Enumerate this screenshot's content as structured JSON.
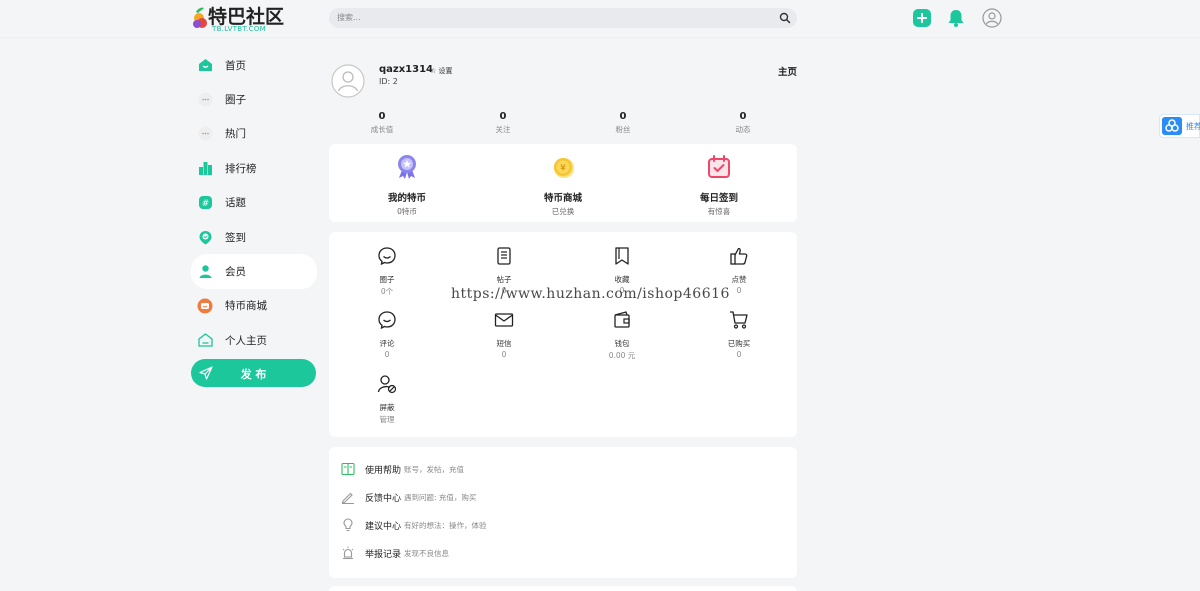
{
  "header": {
    "logo_title": "特巴社区",
    "logo_sub": "TB.LVTBT.COM",
    "search_placeholder": "搜索...",
    "icons": [
      "plus-icon",
      "bell-icon",
      "user-icon"
    ]
  },
  "sidebar": {
    "items": [
      {
        "label": "首页",
        "icon": "home-icon"
      },
      {
        "label": "圈子",
        "icon": "ellipsis-icon"
      },
      {
        "label": "热门",
        "icon": "ellipsis-icon"
      },
      {
        "label": "排行榜",
        "icon": "ranking-icon"
      },
      {
        "label": "话题",
        "icon": "hashtag-icon"
      },
      {
        "label": "签到",
        "icon": "checkin-icon"
      },
      {
        "label": "会员",
        "icon": "member-icon"
      },
      {
        "label": "特币商城",
        "icon": "shop-icon"
      },
      {
        "label": "个人主页",
        "icon": "home-outline-icon"
      }
    ],
    "active_index": 6,
    "publish_label": "发 布"
  },
  "profile": {
    "username": "qazx1314",
    "settings_label": "☆ 设置",
    "user_id": "ID: 2",
    "homepage_label": "主页",
    "stats": [
      {
        "value": "0",
        "label": "成长值"
      },
      {
        "value": "0",
        "label": "关注"
      },
      {
        "value": "0",
        "label": "粉丝"
      },
      {
        "value": "0",
        "label": "动态"
      }
    ]
  },
  "features": [
    {
      "title": "我的特币",
      "sub": "0特币",
      "icon": "medal-icon"
    },
    {
      "title": "特币商城",
      "sub": "已兑换",
      "icon": "coin-icon"
    },
    {
      "title": "每日签到",
      "sub": "有惊喜",
      "icon": "calendar-check-icon"
    }
  ],
  "grid": [
    {
      "label": "圈子",
      "value": "0个",
      "icon": "circle-chat-icon"
    },
    {
      "label": "帖子",
      "value": "0",
      "icon": "document-icon"
    },
    {
      "label": "收藏",
      "value": "0",
      "icon": "bookmark-icon"
    },
    {
      "label": "点赞",
      "value": "0",
      "icon": "thumbs-up-icon"
    },
    {
      "label": "评论",
      "value": "0",
      "icon": "comment-icon"
    },
    {
      "label": "短信",
      "value": "0",
      "icon": "mail-icon"
    },
    {
      "label": "钱包",
      "value": "0.00 元",
      "icon": "wallet-icon"
    },
    {
      "label": "已购买",
      "value": "0",
      "icon": "cart-icon"
    },
    {
      "label": "屏蔽",
      "value": "管理",
      "icon": "block-user-icon"
    }
  ],
  "help": [
    {
      "title": "使用帮助",
      "desc": "账号，发帖，充值",
      "icon": "book-icon"
    },
    {
      "title": "反馈中心",
      "desc": "遇到问题: 充值，购买",
      "icon": "pen-icon"
    },
    {
      "title": "建议中心",
      "desc": "有好的想法：操作，体验",
      "icon": "bulb-icon"
    },
    {
      "title": "举报记录",
      "desc": "发现不良信息",
      "icon": "alarm-icon"
    }
  ],
  "watermark": "https://www.huzhan.com/ishop46616",
  "float_button": {
    "label": "推荐"
  },
  "colors": {
    "accent": "#1cc79c",
    "background": "#f4f5f7",
    "card": "#ffffff"
  }
}
